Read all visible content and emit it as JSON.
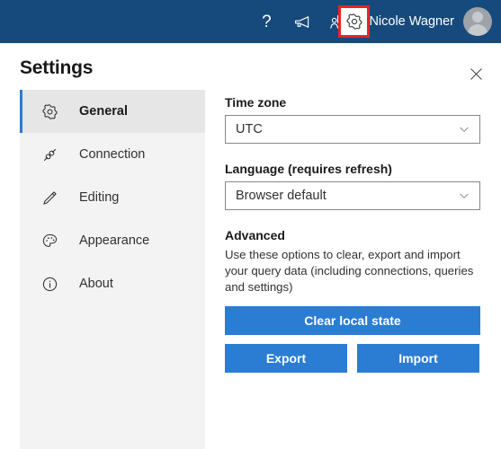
{
  "topbar": {
    "icons": [
      {
        "name": "help-icon",
        "glyph": "?"
      },
      {
        "name": "megaphone-icon"
      },
      {
        "name": "feedback-icon"
      },
      {
        "name": "gear-icon"
      }
    ],
    "user_name": "Nicole Wagner",
    "avatar": "user-avatar",
    "background_color": "#174a7c",
    "highlight_color": "#e8232a"
  },
  "panel": {
    "title": "Settings",
    "close_label": "Close"
  },
  "sidebar": {
    "items": [
      {
        "label": "General",
        "icon": "gear-icon",
        "selected": true
      },
      {
        "label": "Connection",
        "icon": "plug-icon",
        "selected": false
      },
      {
        "label": "Editing",
        "icon": "pencil-icon",
        "selected": false
      },
      {
        "label": "Appearance",
        "icon": "palette-icon",
        "selected": false
      },
      {
        "label": "About",
        "icon": "info-circle-icon",
        "selected": false
      }
    ],
    "accent_color": "#2b7cd3",
    "background_color": "#f3f3f3"
  },
  "main": {
    "timezone": {
      "label": "Time zone",
      "value": "UTC"
    },
    "language": {
      "label": "Language (requires refresh)",
      "value": "Browser default"
    },
    "advanced": {
      "title": "Advanced",
      "description": "Use these options to clear, export and import your query data (including connections, queries and settings)",
      "clear_label": "Clear local state",
      "export_label": "Export",
      "import_label": "Import",
      "button_color": "#2b7cd3"
    }
  }
}
